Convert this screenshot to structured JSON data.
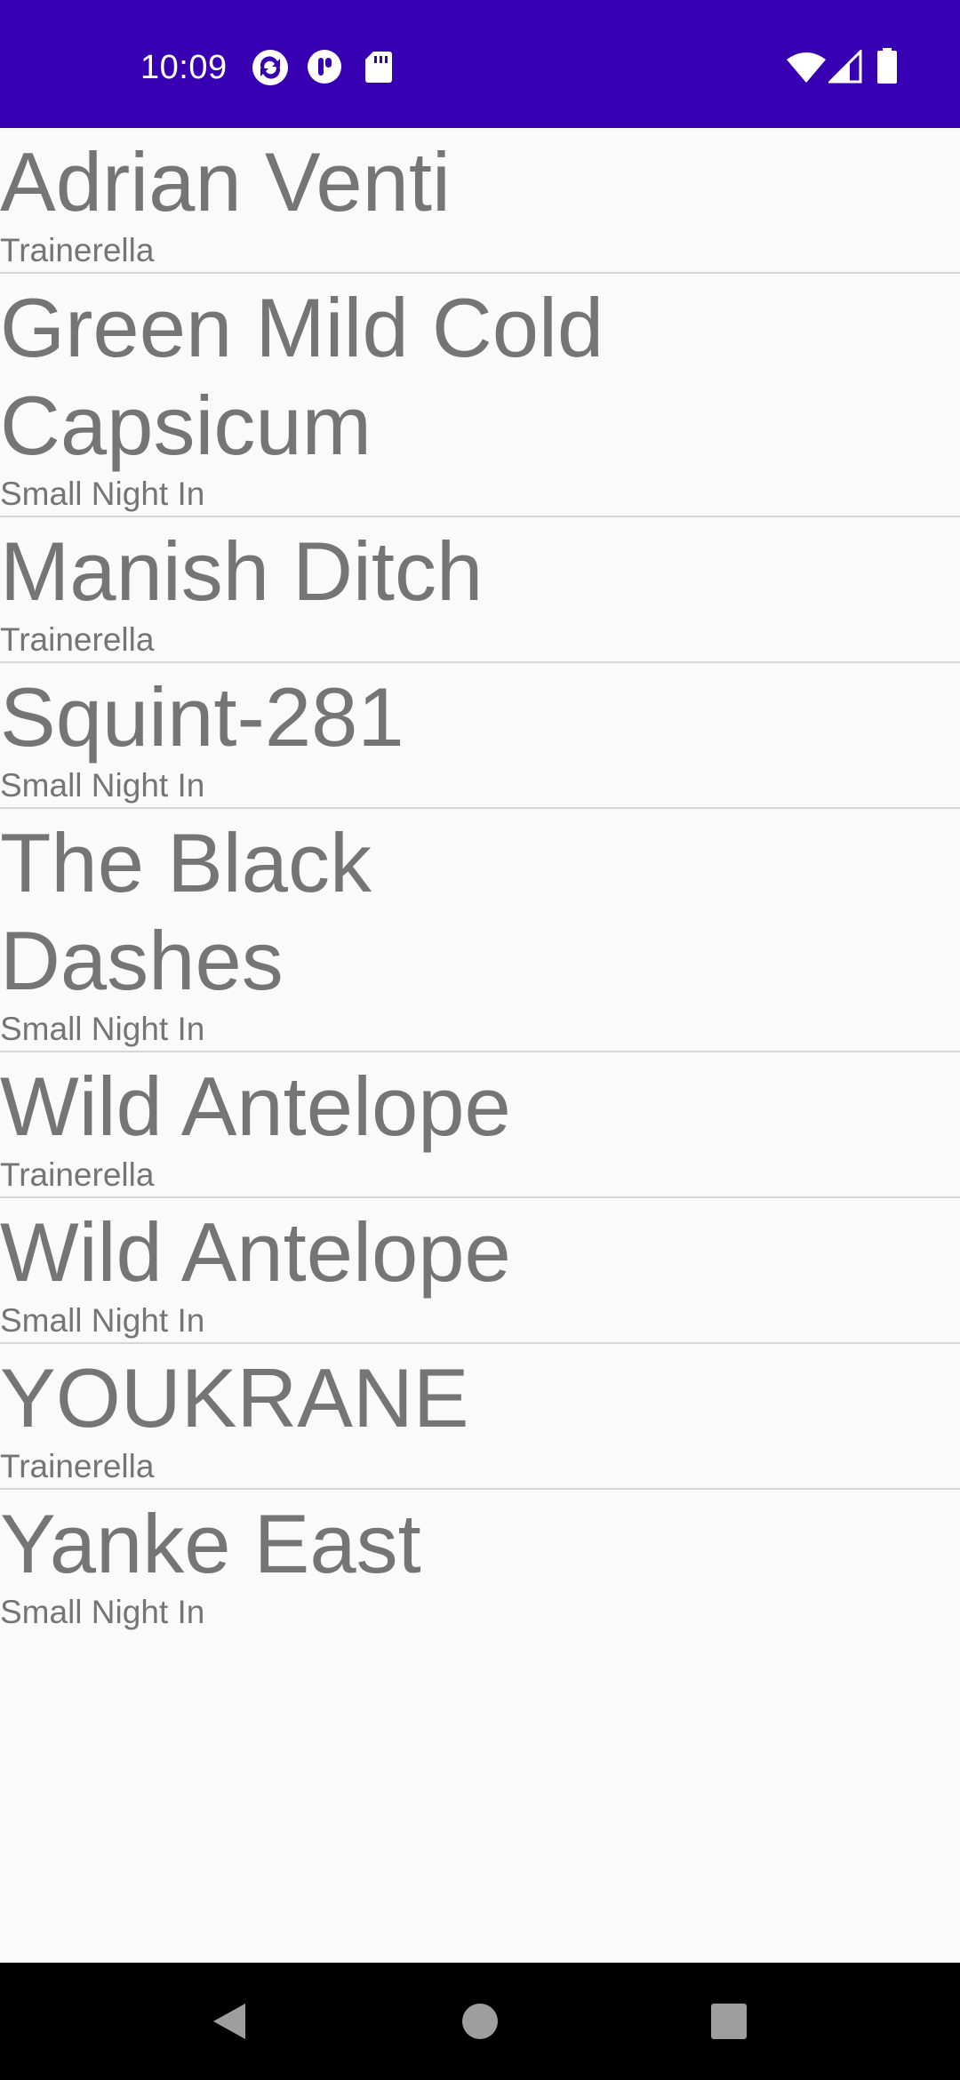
{
  "status_bar": {
    "time": "10:09",
    "background": "#3700b3",
    "left_icons": [
      "sync-icon",
      "pocket-icon",
      "sd-card-icon"
    ],
    "right_icons": [
      "wifi-icon",
      "signal-icon",
      "battery-icon"
    ]
  },
  "list": {
    "items": [
      {
        "title": "Adrian Venti",
        "subtitle": "Trainerella"
      },
      {
        "title": "Green Mild Cold Capsicum",
        "subtitle": "Small Night In"
      },
      {
        "title": "Manish Ditch",
        "subtitle": "Trainerella"
      },
      {
        "title": "Squint-281",
        "subtitle": "Small Night In"
      },
      {
        "title": "The Black Dashes",
        "subtitle": "Small Night In"
      },
      {
        "title": "Wild Antelope",
        "subtitle": "Trainerella"
      },
      {
        "title": "Wild Antelope",
        "subtitle": "Small Night In"
      },
      {
        "title": "YOUKRANE",
        "subtitle": "Trainerella"
      },
      {
        "title": "Yanke East",
        "subtitle": "Small Night In"
      }
    ]
  },
  "nav_bar": {
    "buttons": [
      "back-icon",
      "home-icon",
      "recents-icon"
    ]
  }
}
